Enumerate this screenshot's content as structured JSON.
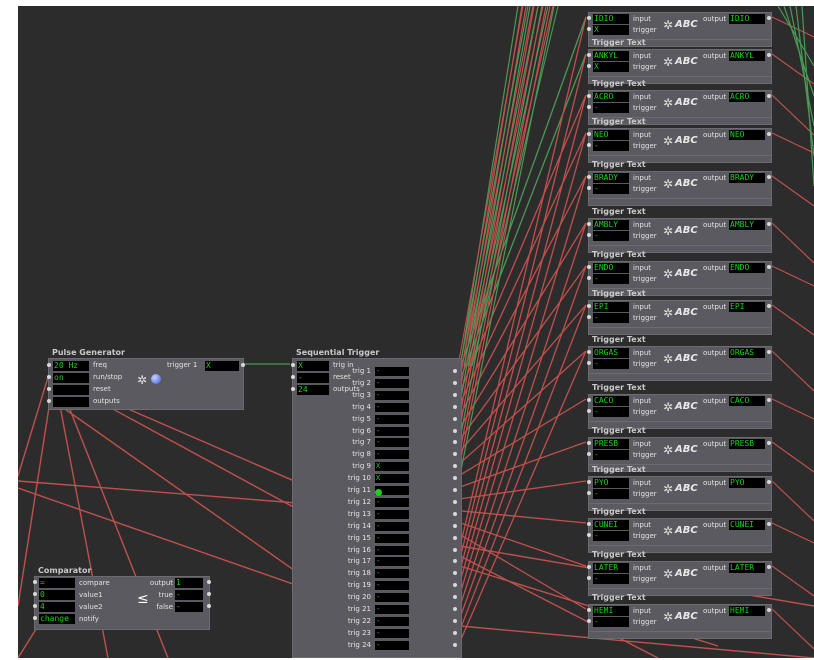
{
  "colors": {
    "canvas": "#2c2c2c",
    "actor": "#5a5a60",
    "field": "#000000",
    "field_text": "#19d119",
    "wire_red": "#c0504d",
    "wire_green": "#4a9a54"
  },
  "pulse": {
    "title": "Pulse Generator",
    "freq_value": "20 Hz",
    "freq_label": "freq",
    "run_value": "on",
    "run_label": "run/stop",
    "reset_label": "reset",
    "output_label": "outputs",
    "trigger_label": "trigger 1",
    "trigger_value": "X"
  },
  "seq": {
    "title": "Sequential Trigger",
    "in1_value": "X",
    "in1_label": "trig in",
    "in2_value": "-",
    "in2_label": "reset",
    "in3_value": "24",
    "in3_label": "outputs",
    "triggers": [
      {
        "label": "trig 1",
        "value": "-"
      },
      {
        "label": "trig 2",
        "value": "-"
      },
      {
        "label": "trig 3",
        "value": "-"
      },
      {
        "label": "trig 4",
        "value": "-"
      },
      {
        "label": "trig 5",
        "value": "-"
      },
      {
        "label": "trig 6",
        "value": "-"
      },
      {
        "label": "trig 7",
        "value": "-"
      },
      {
        "label": "trig 8",
        "value": "-"
      },
      {
        "label": "trig 9",
        "value": "X"
      },
      {
        "label": "trig 10",
        "value": "X"
      },
      {
        "label": "trig 11",
        "value": "-"
      },
      {
        "label": "trig 12",
        "value": "-"
      },
      {
        "label": "trig 13",
        "value": "-"
      },
      {
        "label": "trig 14",
        "value": "-"
      },
      {
        "label": "trig 15",
        "value": "-"
      },
      {
        "label": "trig 16",
        "value": "-"
      },
      {
        "label": "trig 17",
        "value": "-"
      },
      {
        "label": "trig 18",
        "value": "-"
      },
      {
        "label": "trig 19",
        "value": "-"
      },
      {
        "label": "trig 20",
        "value": "-"
      },
      {
        "label": "trig 21",
        "value": "-"
      },
      {
        "label": "trig 22",
        "value": "-"
      },
      {
        "label": "trig 23",
        "value": "-"
      },
      {
        "label": "trig 24",
        "value": "-"
      }
    ]
  },
  "comparator": {
    "title": "Comparator",
    "r1_value": "=",
    "r1_label": "compare",
    "r2_value": "0",
    "r2_label": "value1",
    "r3_value": "4",
    "r3_label": "value2",
    "r4_value": "change",
    "r4_label": "notify",
    "out1_label": "output",
    "out1_value": "1",
    "out2_label": "true",
    "out2_value": "-",
    "out3_label": "false",
    "out3_value": "-",
    "symbol": "≤"
  },
  "text_actor": {
    "title": "Trigger Text",
    "input_label": "input",
    "trigger_label": "trigger",
    "output_label": "output",
    "abc": "ABC"
  },
  "text_actors": [
    {
      "value": "IDIO",
      "sub": "X",
      "output": "IDIO"
    },
    {
      "value": "ANKYL",
      "sub": "X",
      "output": "ANKYL"
    },
    {
      "value": "ACRO",
      "sub": "-",
      "output": "ACRO"
    },
    {
      "value": "NEO",
      "sub": "-",
      "output": "NEO"
    },
    {
      "value": "BRADY",
      "sub": "-",
      "output": "BRADY"
    },
    {
      "value": "AMBLY",
      "sub": "-",
      "output": "AMBLY"
    },
    {
      "value": "ENDO",
      "sub": "-",
      "output": "ENDO"
    },
    {
      "value": "EPI",
      "sub": "-",
      "output": "EPI"
    },
    {
      "value": "ORGAS",
      "sub": "-",
      "output": "ORGAS"
    },
    {
      "value": "CACO",
      "sub": "-",
      "output": "CACO"
    },
    {
      "value": "PRESB",
      "sub": "-",
      "output": "PRESB"
    },
    {
      "value": "PYO",
      "sub": "-",
      "output": "PYO"
    },
    {
      "value": "CUNEI",
      "sub": "-",
      "output": "CUNEI"
    },
    {
      "value": "LATER",
      "sub": "-",
      "output": "LATER"
    },
    {
      "value": "HEMI",
      "sub": "-",
      "output": "HEMI"
    }
  ]
}
